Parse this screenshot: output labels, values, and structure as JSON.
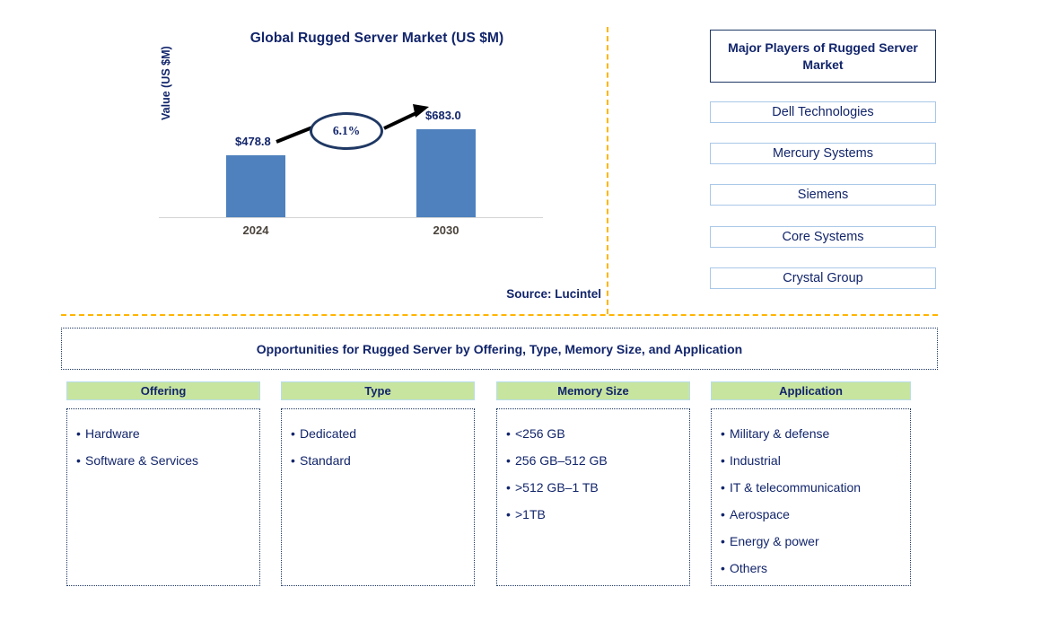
{
  "chart_data": {
    "type": "bar",
    "title": "Global Rugged Server Market (US $M)",
    "xlabel": "",
    "ylabel": "Value (US $M)",
    "categories": [
      "2024",
      "2030"
    ],
    "values": [
      478.8,
      683.0
    ],
    "value_labels": [
      "$478.8",
      "$683.0"
    ],
    "ylim": [
      0,
      780
    ],
    "grid": false,
    "legend": "none",
    "bar_color": "#4E81BD",
    "annotation": {
      "label": "6.1%",
      "shape": "ellipse",
      "meaning": "CAGR between 2024 and 2030",
      "arrow": "from 2024 bar label to 2030 bar label"
    }
  },
  "chart_panel": {
    "title": "Global Rugged Server Market (US $M)",
    "y_axis_label": "Value (US $M)",
    "bars": [
      {
        "category": "2024",
        "label": "$478.8",
        "value": 478.8
      },
      {
        "category": "2030",
        "label": "$683.0",
        "value": 683.0
      }
    ],
    "cagr_label": "6.1%",
    "source": "Source: Lucintel"
  },
  "players_panel": {
    "header": "Major Players of Rugged Server Market",
    "players": [
      {
        "name": "Dell Technologies"
      },
      {
        "name": "Mercury Systems"
      },
      {
        "name": "Siemens"
      },
      {
        "name": "Core Systems"
      },
      {
        "name": "Crystal Group"
      }
    ]
  },
  "opportunities": {
    "banner": "Opportunities for Rugged Server by Offering, Type, Memory Size, and Application",
    "columns": [
      {
        "header": "Offering",
        "items": [
          "Hardware",
          "Software & Services"
        ]
      },
      {
        "header": "Type",
        "items": [
          "Dedicated",
          "Standard"
        ]
      },
      {
        "header": "Memory Size",
        "items": [
          "<256 GB",
          "256 GB–512 GB",
          ">512 GB–1 TB",
          ">1TB"
        ]
      },
      {
        "header": "Application",
        "items": [
          "Military & defense",
          "Industrial",
          "IT & telecommunication",
          "Aerospace",
          "Energy & power",
          "Others"
        ]
      }
    ]
  },
  "colors": {
    "navy": "#12256B",
    "bar_blue": "#4E81BD",
    "divider_orange": "#FFB400",
    "header_green": "#C8E5A0",
    "box_border_blue": "#A9C7E8"
  }
}
